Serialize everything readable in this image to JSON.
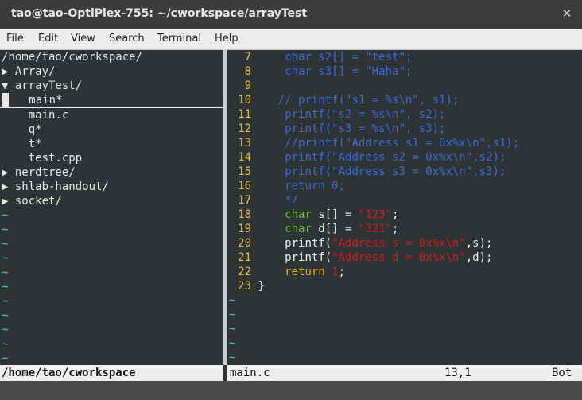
{
  "window": {
    "title": "tao@tao-OptiPlex-755: ~/cworkspace/arrayTest",
    "close_symbol": "✕"
  },
  "menu": [
    "File",
    "Edit",
    "View",
    "Search",
    "Terminal",
    "Help"
  ],
  "tree": {
    "lines": [
      "/home/tao/cworkspace/",
      "▶ Array/",
      "▼ arrayTest/",
      "    main*",
      "    main.c",
      "    q*",
      "    t*",
      "    test.cpp",
      "▶ nerdtree/",
      "▶ shlab-handout/",
      "▶ socket/"
    ],
    "selected_index": 3,
    "filler": "~"
  },
  "code": {
    "lines": [
      {
        "n": "7",
        "t": [
          {
            "c": "cm",
            "s": "    char s2[] = \"test\";"
          }
        ]
      },
      {
        "n": "8",
        "t": [
          {
            "c": "cm",
            "s": "    char s3[] = \"Haha\";"
          }
        ]
      },
      {
        "n": "9",
        "t": [
          {
            "c": "fg",
            "s": ""
          }
        ]
      },
      {
        "n": "10",
        "t": [
          {
            "c": "cm",
            "s": "   // printf(\"s1 = %s\\n\", s1);"
          }
        ]
      },
      {
        "n": "11",
        "t": [
          {
            "c": "cm",
            "s": "    printf(\"s2 = %s\\n\", s2);"
          }
        ]
      },
      {
        "n": "12",
        "t": [
          {
            "c": "cm",
            "s": "    printf(\"s3 = %s\\n\", s3);"
          }
        ]
      },
      {
        "n": "13",
        "t": [
          {
            "c": "cm",
            "s": "    //printf(\"Address s1 = 0x%x\\n\",s1);"
          }
        ]
      },
      {
        "n": "14",
        "t": [
          {
            "c": "cm",
            "s": "    printf(\"Address s2 = 0x%x\\n\",s2);"
          }
        ]
      },
      {
        "n": "15",
        "t": [
          {
            "c": "cm",
            "s": "    printf(\"Address s3 = 0x%x\\n\",s3);"
          }
        ]
      },
      {
        "n": "16",
        "t": [
          {
            "c": "cm",
            "s": "    return 0;"
          }
        ]
      },
      {
        "n": "17",
        "t": [
          {
            "c": "cm",
            "s": "    */"
          }
        ]
      },
      {
        "n": "18",
        "t": [
          {
            "c": "fg",
            "s": "    "
          },
          {
            "c": "kw",
            "s": "char"
          },
          {
            "c": "fg",
            "s": " s[] = "
          },
          {
            "c": "str",
            "s": "\"123\""
          },
          {
            "c": "fg",
            "s": ";"
          }
        ]
      },
      {
        "n": "19",
        "t": [
          {
            "c": "fg",
            "s": "    "
          },
          {
            "c": "kw",
            "s": "char"
          },
          {
            "c": "fg",
            "s": " d[] = "
          },
          {
            "c": "str",
            "s": "\"321\""
          },
          {
            "c": "fg",
            "s": ";"
          }
        ]
      },
      {
        "n": "20",
        "t": [
          {
            "c": "fg",
            "s": "    printf("
          },
          {
            "c": "str",
            "s": "\"Address s = 0x%x\\n\""
          },
          {
            "c": "fg",
            "s": ",s);"
          }
        ]
      },
      {
        "n": "21",
        "t": [
          {
            "c": "fg",
            "s": "    printf("
          },
          {
            "c": "str",
            "s": "\"Address d = 0x%x\\n\""
          },
          {
            "c": "fg",
            "s": ",d);"
          }
        ]
      },
      {
        "n": "22",
        "t": [
          {
            "c": "fg",
            "s": "    "
          },
          {
            "c": "rkw",
            "s": "return"
          },
          {
            "c": "fg",
            "s": " "
          },
          {
            "c": "num",
            "s": "1"
          },
          {
            "c": "fg",
            "s": ";"
          }
        ]
      },
      {
        "n": "23",
        "t": [
          {
            "c": "fg",
            "s": "}"
          }
        ]
      }
    ],
    "filler": "~"
  },
  "status": {
    "left": "/home/tao/cworkspace",
    "file": "main.c",
    "position": "13,1",
    "scroll": "Bot"
  },
  "colors": {
    "background": "#2e3436",
    "line_number": "#e8c13b",
    "comment": "#3a6bd6",
    "type_keyword": "#6ec23b",
    "string": "#cc2020",
    "filler": "#34e2e2"
  }
}
